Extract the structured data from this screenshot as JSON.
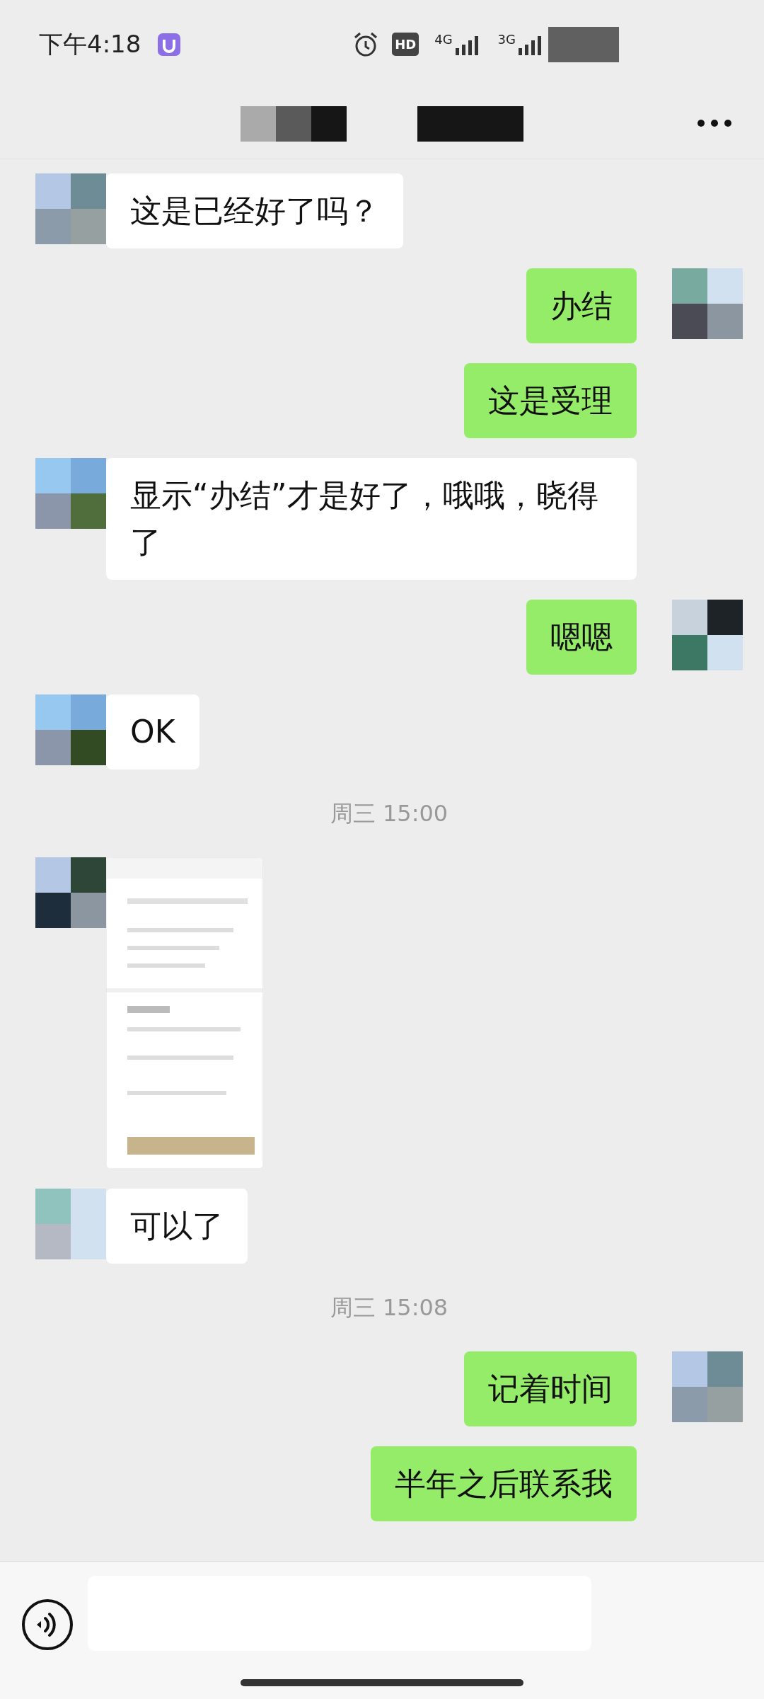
{
  "status_bar": {
    "time": "下午4:18",
    "hd": "HD",
    "networks": [
      "4G",
      "3G"
    ]
  },
  "messages": [
    {
      "kind": "text",
      "outgoing": false,
      "avatar": true,
      "text": "这是已经好了吗？"
    },
    {
      "kind": "text",
      "outgoing": true,
      "avatar": true,
      "text": "办结"
    },
    {
      "kind": "text",
      "outgoing": true,
      "avatar": false,
      "text": "这是受理"
    },
    {
      "kind": "text",
      "outgoing": false,
      "avatar": true,
      "text": "显示“办结”才是好了，哦哦，晓得了"
    },
    {
      "kind": "text",
      "outgoing": true,
      "avatar": true,
      "text": "嗯嗯"
    },
    {
      "kind": "text",
      "outgoing": false,
      "avatar": true,
      "text": "OK"
    },
    {
      "kind": "time",
      "text": "周三 15:00"
    },
    {
      "kind": "picture",
      "outgoing": false,
      "avatar": true
    },
    {
      "kind": "text",
      "outgoing": false,
      "avatar": true,
      "text": "可以了"
    },
    {
      "kind": "time",
      "text": "周三 15:08"
    },
    {
      "kind": "text",
      "outgoing": true,
      "avatar": true,
      "text": "记着时间"
    },
    {
      "kind": "text",
      "outgoing": true,
      "avatar": false,
      "text": "半年之后联系我"
    }
  ]
}
